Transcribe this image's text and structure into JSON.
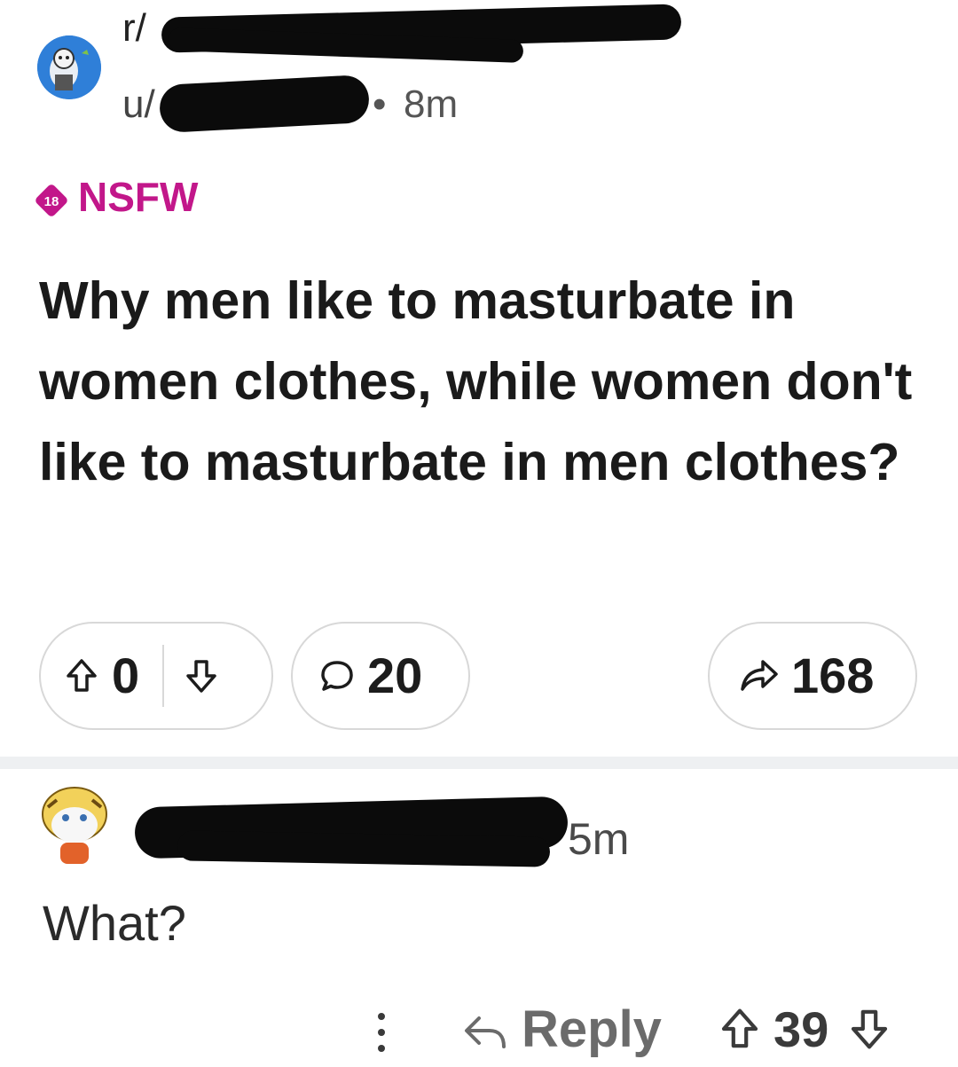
{
  "post": {
    "subreddit_prefix": "r/",
    "user_prefix": "u/",
    "separator": "•",
    "age": "8m",
    "tag_badge": "18",
    "tag": "NSFW",
    "title": "Why men like to masturbate in women clothes, while women don't like to masturbate in men clothes?",
    "votes": "0",
    "comments": "20",
    "shares": "168"
  },
  "comment": {
    "age": "5m",
    "body": "What?",
    "reply_label": "Reply",
    "score": "39"
  },
  "colors": {
    "nsfw": "#c2178a",
    "text": "#1c1c1c",
    "pill_border": "#d8d8d8",
    "redaction": "#0b0b0b"
  },
  "icons": [
    "upvote-icon",
    "downvote-icon",
    "comment-icon",
    "share-icon",
    "more-icon",
    "reply-icon"
  ]
}
